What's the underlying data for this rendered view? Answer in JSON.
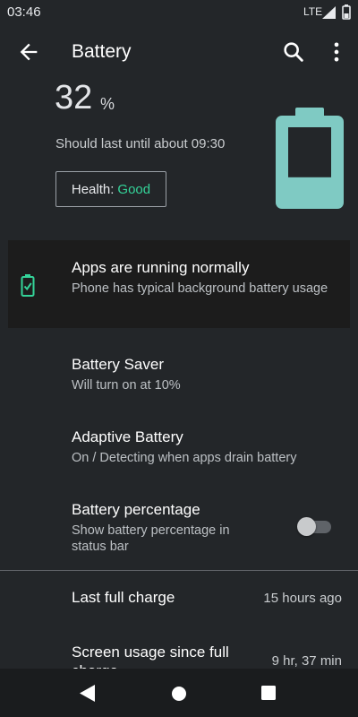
{
  "status_bar": {
    "time": "03:46",
    "network": "LTE"
  },
  "toolbar": {
    "title": "Battery",
    "back_icon": "arrow-back-icon",
    "search_icon": "search-icon",
    "menu_icon": "more-vert-icon"
  },
  "header": {
    "percent": "32",
    "percent_sign": "%",
    "estimate": "Should last until about 09:30",
    "health_label": "Health:",
    "health_value": "Good",
    "level": 0.32
  },
  "card": {
    "title": "Apps are running normally",
    "subtitle": "Phone has typical background battery usage",
    "icon": "battery-check-icon"
  },
  "settings": [
    {
      "title": "Battery Saver",
      "subtitle": "Will turn on at 10%"
    },
    {
      "title": "Adaptive Battery",
      "subtitle": "On / Detecting when apps drain battery"
    },
    {
      "title": "Battery percentage",
      "subtitle": "Show battery percentage in status bar",
      "toggle": false
    }
  ],
  "usage": [
    {
      "label": "Last full charge",
      "value": "15 hours ago"
    },
    {
      "label": "Screen usage since full charge",
      "value": "9 hr, 37 min"
    }
  ],
  "colors": {
    "background": "#232629",
    "accent": "#7fcac3",
    "good": "#34d399",
    "card_bg": "#1c1c1c"
  }
}
